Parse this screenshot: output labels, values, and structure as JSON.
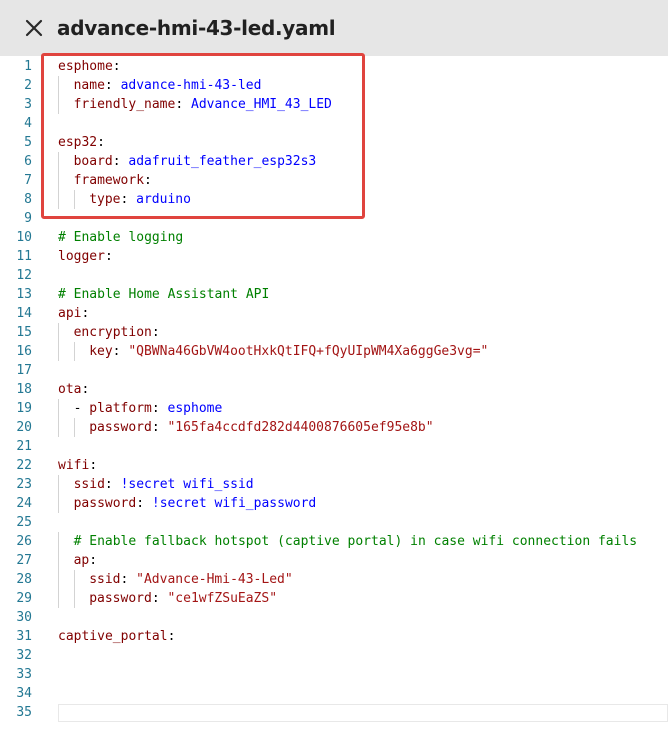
{
  "header": {
    "close_icon": "close-icon",
    "filename": "advance-hmi-43-led.yaml"
  },
  "colors": {
    "key": "#800000",
    "string": "#a31515",
    "tag": "#0000ff",
    "comment": "#008000",
    "line_number": "#237893",
    "highlight_border": "#e0443e"
  },
  "editor": {
    "lines": [
      {
        "n": "1",
        "indent": 0,
        "tokens": [
          {
            "t": "esphome",
            "c": "key"
          },
          {
            "t": ":",
            "c": ""
          }
        ]
      },
      {
        "n": "2",
        "indent": 1,
        "tokens": [
          {
            "t": "name",
            "c": "key"
          },
          {
            "t": ": ",
            "c": ""
          },
          {
            "t": "advance-hmi-43-led",
            "c": "kw"
          }
        ]
      },
      {
        "n": "3",
        "indent": 1,
        "tokens": [
          {
            "t": "friendly_name",
            "c": "key"
          },
          {
            "t": ": ",
            "c": ""
          },
          {
            "t": "Advance_HMI_43_LED",
            "c": "kw"
          }
        ]
      },
      {
        "n": "4",
        "indent": 0,
        "tokens": []
      },
      {
        "n": "5",
        "indent": 0,
        "tokens": [
          {
            "t": "esp32",
            "c": "key"
          },
          {
            "t": ":",
            "c": ""
          }
        ]
      },
      {
        "n": "6",
        "indent": 1,
        "tokens": [
          {
            "t": "board",
            "c": "key"
          },
          {
            "t": ": ",
            "c": ""
          },
          {
            "t": "adafruit_feather_esp32s3",
            "c": "kw"
          }
        ]
      },
      {
        "n": "7",
        "indent": 1,
        "tokens": [
          {
            "t": "framework",
            "c": "key"
          },
          {
            "t": ":",
            "c": ""
          }
        ]
      },
      {
        "n": "8",
        "indent": 2,
        "tokens": [
          {
            "t": "type",
            "c": "key"
          },
          {
            "t": ": ",
            "c": ""
          },
          {
            "t": "arduino",
            "c": "kw"
          }
        ]
      },
      {
        "n": "9",
        "indent": 0,
        "tokens": []
      },
      {
        "n": "10",
        "indent": 0,
        "tokens": [
          {
            "t": "# Enable logging",
            "c": "comment"
          }
        ]
      },
      {
        "n": "11",
        "indent": 0,
        "tokens": [
          {
            "t": "logger",
            "c": "key"
          },
          {
            "t": ":",
            "c": ""
          }
        ]
      },
      {
        "n": "12",
        "indent": 0,
        "tokens": []
      },
      {
        "n": "13",
        "indent": 0,
        "tokens": [
          {
            "t": "# Enable Home Assistant API",
            "c": "comment"
          }
        ]
      },
      {
        "n": "14",
        "indent": 0,
        "tokens": [
          {
            "t": "api",
            "c": "key"
          },
          {
            "t": ":",
            "c": ""
          }
        ]
      },
      {
        "n": "15",
        "indent": 1,
        "tokens": [
          {
            "t": "encryption",
            "c": "key"
          },
          {
            "t": ":",
            "c": ""
          }
        ]
      },
      {
        "n": "16",
        "indent": 2,
        "tokens": [
          {
            "t": "key",
            "c": "key"
          },
          {
            "t": ": ",
            "c": ""
          },
          {
            "t": "\"QBWNa46GbVW4ootHxkQtIFQ+fQyUIpWM4Xa6ggGe3vg=\"",
            "c": "str"
          }
        ]
      },
      {
        "n": "17",
        "indent": 0,
        "tokens": []
      },
      {
        "n": "18",
        "indent": 0,
        "tokens": [
          {
            "t": "ota",
            "c": "key"
          },
          {
            "t": ":",
            "c": ""
          }
        ]
      },
      {
        "n": "19",
        "indent": 1,
        "tokens": [
          {
            "t": "- ",
            "c": ""
          },
          {
            "t": "platform",
            "c": "key"
          },
          {
            "t": ": ",
            "c": ""
          },
          {
            "t": "esphome",
            "c": "kw"
          }
        ]
      },
      {
        "n": "20",
        "indent": 2,
        "tokens": [
          {
            "t": "password",
            "c": "key"
          },
          {
            "t": ": ",
            "c": ""
          },
          {
            "t": "\"165fa4ccdfd282d4400876605ef95e8b\"",
            "c": "str"
          }
        ]
      },
      {
        "n": "21",
        "indent": 0,
        "tokens": []
      },
      {
        "n": "22",
        "indent": 0,
        "tokens": [
          {
            "t": "wifi",
            "c": "key"
          },
          {
            "t": ":",
            "c": ""
          }
        ]
      },
      {
        "n": "23",
        "indent": 1,
        "tokens": [
          {
            "t": "ssid",
            "c": "key"
          },
          {
            "t": ": ",
            "c": ""
          },
          {
            "t": "!secret",
            "c": "kw"
          },
          {
            "t": " ",
            "c": ""
          },
          {
            "t": "wifi_ssid",
            "c": "kw"
          }
        ]
      },
      {
        "n": "24",
        "indent": 1,
        "tokens": [
          {
            "t": "password",
            "c": "key"
          },
          {
            "t": ": ",
            "c": ""
          },
          {
            "t": "!secret",
            "c": "kw"
          },
          {
            "t": " ",
            "c": ""
          },
          {
            "t": "wifi_password",
            "c": "kw"
          }
        ]
      },
      {
        "n": "25",
        "indent": 0,
        "tokens": []
      },
      {
        "n": "26",
        "indent": 1,
        "tokens": [
          {
            "t": "# Enable fallback hotspot (captive portal) in case wifi connection fails",
            "c": "comment"
          }
        ]
      },
      {
        "n": "27",
        "indent": 1,
        "tokens": [
          {
            "t": "ap",
            "c": "key"
          },
          {
            "t": ":",
            "c": ""
          }
        ]
      },
      {
        "n": "28",
        "indent": 2,
        "tokens": [
          {
            "t": "ssid",
            "c": "key"
          },
          {
            "t": ": ",
            "c": ""
          },
          {
            "t": "\"Advance-Hmi-43-Led\"",
            "c": "str"
          }
        ]
      },
      {
        "n": "29",
        "indent": 2,
        "tokens": [
          {
            "t": "password",
            "c": "key"
          },
          {
            "t": ": ",
            "c": ""
          },
          {
            "t": "\"ce1wfZSuEaZS\"",
            "c": "str"
          }
        ]
      },
      {
        "n": "30",
        "indent": 0,
        "tokens": []
      },
      {
        "n": "31",
        "indent": 0,
        "tokens": [
          {
            "t": "captive_portal",
            "c": "key"
          },
          {
            "t": ":",
            "c": ""
          }
        ]
      },
      {
        "n": "32",
        "indent": 0,
        "tokens": []
      },
      {
        "n": "33",
        "indent": 0,
        "tokens": []
      },
      {
        "n": "34",
        "indent": 0,
        "tokens": []
      },
      {
        "n": "35",
        "indent": 0,
        "tokens": []
      }
    ]
  }
}
